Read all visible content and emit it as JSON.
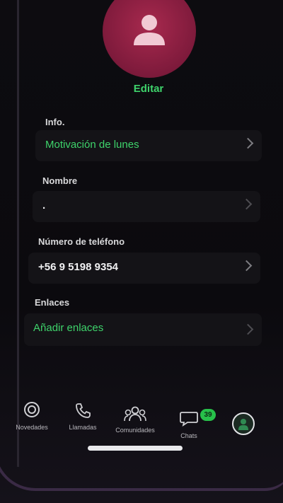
{
  "profile": {
    "edit_label": "Editar"
  },
  "info": {
    "label": "Info.",
    "value": "Motivación de lunes"
  },
  "name": {
    "label": "Nombre",
    "value": "."
  },
  "phone": {
    "label": "Número de teléfono",
    "value": "+56 9 5198 9354"
  },
  "links": {
    "label": "Enlaces",
    "add_label": "Añadir enlaces"
  },
  "tabbar": {
    "items": [
      {
        "label": "Novedades",
        "icon": "updates-icon"
      },
      {
        "label": "Llamadas",
        "icon": "phone-icon"
      },
      {
        "label": "Comunidades",
        "icon": "communities-icon"
      },
      {
        "label": "Chats",
        "icon": "chats-icon"
      },
      {
        "label": "",
        "icon": "profile-avatar-icon"
      }
    ],
    "chats_badge": "39"
  },
  "colors": {
    "accent": "#3ed36b",
    "avatar": "#a8294e",
    "background": "#0c0b0e",
    "badge": "#27c14a"
  }
}
